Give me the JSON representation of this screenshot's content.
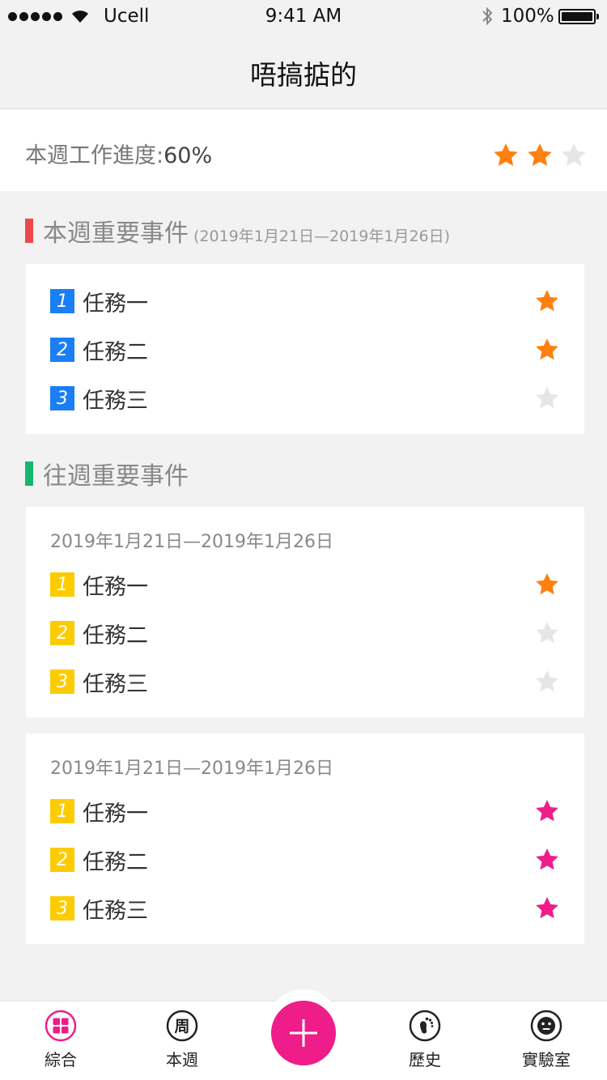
{
  "status_bar": {
    "carrier": "Ucell",
    "time": "9:41 AM",
    "battery": "100%"
  },
  "nav": {
    "title": "唔搞掂的"
  },
  "progress": {
    "label": "本週工作進度:",
    "value": "60%",
    "rating": 2,
    "rating_max": 3
  },
  "colors": {
    "star_orange": "#ff7f0f",
    "star_pink": "#ee1d8a",
    "star_empty": "#e6e6e6",
    "current_bar": "#f0474e",
    "past_bar": "#14b56f",
    "num_blue": "#1a7ef5",
    "num_yellow": "#fccc00",
    "accent": "#ee1d8a"
  },
  "current_week": {
    "title": "本週重要事件",
    "period": "(2019年1月21日—2019年1月26日)",
    "tasks": [
      {
        "num": "1",
        "name": "任務一",
        "starred": true
      },
      {
        "num": "2",
        "name": "任務二",
        "starred": true
      },
      {
        "num": "3",
        "name": "任務三",
        "starred": false
      }
    ]
  },
  "past_weeks": {
    "title": "往週重要事件",
    "weeks": [
      {
        "period": "2019年1月21日—2019年1月26日",
        "tasks": [
          {
            "num": "1",
            "name": "任務一",
            "starred": true
          },
          {
            "num": "2",
            "name": "任務二",
            "starred": false
          },
          {
            "num": "3",
            "name": "任務三",
            "starred": false
          }
        ]
      },
      {
        "period": "2019年1月21日—2019年1月26日",
        "tasks": [
          {
            "num": "1",
            "name": "任務一",
            "starred": true
          },
          {
            "num": "2",
            "name": "任務二",
            "starred": true
          },
          {
            "num": "3",
            "name": "任務三",
            "starred": true
          }
        ]
      }
    ]
  },
  "tab_bar": {
    "tabs": [
      {
        "label": "綜合",
        "icon": "grid-icon"
      },
      {
        "label": "本週",
        "icon": "week-icon",
        "glyph": "周"
      },
      {
        "label": "歷史",
        "icon": "footprint-icon"
      },
      {
        "label": "實驗室",
        "icon": "face-icon"
      }
    ],
    "add_button": {
      "icon": "plus-icon"
    }
  }
}
